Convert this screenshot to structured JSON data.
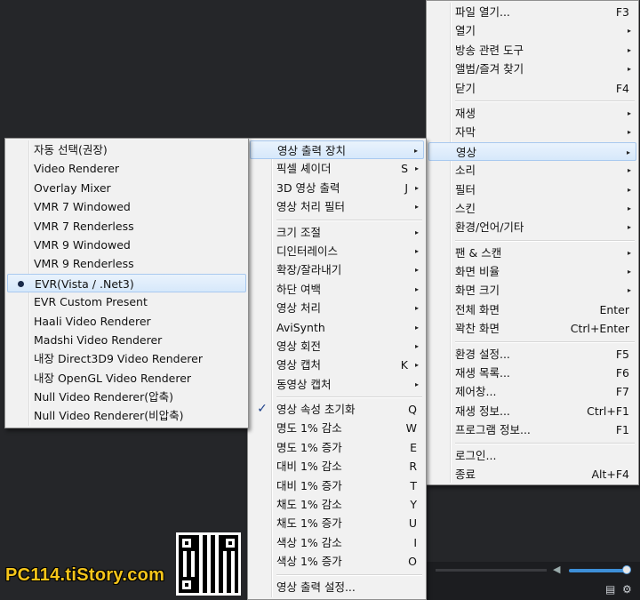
{
  "watermark": "PC114.tiStory.com",
  "main_menu": [
    {
      "label": "파일 열기...",
      "shortcut": "F3"
    },
    {
      "label": "열기",
      "arrow": "▸"
    },
    {
      "label": "방송 관련 도구",
      "arrow": "▸"
    },
    {
      "label": "앨범/즐겨 찾기",
      "arrow": "▸"
    },
    {
      "label": "닫기",
      "shortcut": "F4"
    },
    {
      "sep": true
    },
    {
      "label": "재생",
      "arrow": "▸"
    },
    {
      "label": "자막",
      "arrow": "▸"
    },
    {
      "label": "영상",
      "arrow": "▸",
      "highlight": true
    },
    {
      "label": "소리",
      "arrow": "▸"
    },
    {
      "label": "필터",
      "arrow": "▸"
    },
    {
      "label": "스킨",
      "arrow": "▸"
    },
    {
      "label": "환경/언어/기타",
      "arrow": "▸"
    },
    {
      "sep": true
    },
    {
      "label": "팬 & 스캔",
      "arrow": "▸"
    },
    {
      "label": "화면 비율",
      "arrow": "▸"
    },
    {
      "label": "화면 크기",
      "arrow": "▸"
    },
    {
      "label": "전체 화면",
      "shortcut": "Enter"
    },
    {
      "label": "꽉찬 화면",
      "shortcut": "Ctrl+Enter"
    },
    {
      "sep": true
    },
    {
      "label": "환경 설정...",
      "shortcut": "F5"
    },
    {
      "label": "재생 목록...",
      "shortcut": "F6"
    },
    {
      "label": "제어창...",
      "shortcut": "F7"
    },
    {
      "label": "재생 정보...",
      "shortcut": "Ctrl+F1"
    },
    {
      "label": "프로그램 정보...",
      "shortcut": "F1"
    },
    {
      "sep": true
    },
    {
      "label": "로그인..."
    },
    {
      "label": "종료",
      "shortcut": "Alt+F4"
    }
  ],
  "video_menu": [
    {
      "label": "영상 출력 장치",
      "arrow": "▸",
      "highlight": true
    },
    {
      "label": "픽셀 셰이더",
      "shortcut": "S",
      "arrow": "▸"
    },
    {
      "label": "3D 영상 출력",
      "shortcut": "J",
      "arrow": "▸"
    },
    {
      "label": "영상 처리 필터",
      "arrow": "▸"
    },
    {
      "sep": true
    },
    {
      "label": "크기 조절",
      "arrow": "▸"
    },
    {
      "label": "디인터레이스",
      "arrow": "▸"
    },
    {
      "label": "확장/잘라내기",
      "arrow": "▸"
    },
    {
      "label": "하단 여백",
      "arrow": "▸"
    },
    {
      "label": "영상 처리",
      "arrow": "▸"
    },
    {
      "label": "AviSynth",
      "arrow": "▸"
    },
    {
      "label": "영상 회전",
      "arrow": "▸"
    },
    {
      "label": "영상 캡처",
      "shortcut": "K",
      "arrow": "▸"
    },
    {
      "label": "동영상 캡처",
      "arrow": "▸"
    },
    {
      "sep": true
    },
    {
      "label": "영상 속성 초기화",
      "shortcut": "Q",
      "check": "✓"
    },
    {
      "label": "명도 1% 감소",
      "shortcut": "W"
    },
    {
      "label": "명도 1% 증가",
      "shortcut": "E"
    },
    {
      "label": "대비 1% 감소",
      "shortcut": "R"
    },
    {
      "label": "대비 1% 증가",
      "shortcut": "T"
    },
    {
      "label": "채도 1% 감소",
      "shortcut": "Y"
    },
    {
      "label": "채도 1% 증가",
      "shortcut": "U"
    },
    {
      "label": "색상 1% 감소",
      "shortcut": "I"
    },
    {
      "label": "색상 1% 증가",
      "shortcut": "O"
    },
    {
      "sep": true
    },
    {
      "label": "영상 출력 설정..."
    }
  ],
  "renderer_menu": [
    {
      "label": "자동 선택(권장)"
    },
    {
      "label": "Video Renderer"
    },
    {
      "label": "Overlay Mixer"
    },
    {
      "label": "VMR 7 Windowed"
    },
    {
      "label": "VMR 7 Renderless"
    },
    {
      "label": "VMR 9 Windowed"
    },
    {
      "label": "VMR 9 Renderless"
    },
    {
      "label": "EVR(Vista / .Net3)",
      "selected": true,
      "highlight": true
    },
    {
      "label": "EVR Custom Present"
    },
    {
      "label": "Haali Video Renderer"
    },
    {
      "label": "Madshi Video Renderer"
    },
    {
      "label": "내장 Direct3D9 Video Renderer"
    },
    {
      "label": "내장 OpenGL Video Renderer"
    },
    {
      "label": "Null Video Renderer(압축)"
    },
    {
      "label": "Null Video Renderer(비압축)"
    }
  ],
  "player": {
    "volume_fraction": 0.92,
    "volume_icon": "speaker-icon",
    "playlist_icon": "playlist-icon",
    "settings_icon": "gear-icon"
  },
  "colors": {
    "highlight_top": "#eaf3fc",
    "highlight_bottom": "#d6e8fb",
    "highlight_border": "#a9c9ef",
    "menu_bg": "#f1f1f1",
    "accent": "#3d8fd8",
    "watermark": "#f5c51a"
  }
}
